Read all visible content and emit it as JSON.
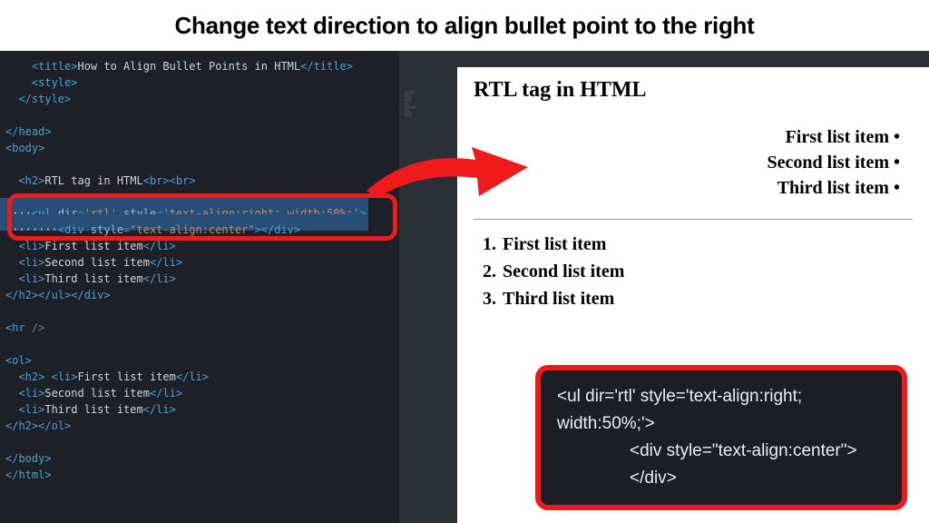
{
  "header": {
    "title": "Change text direction to align bullet point to the right"
  },
  "editor": {
    "lines": [
      {
        "indent": "    ",
        "tokens": [
          {
            "t": "tag",
            "v": "<title>"
          },
          {
            "t": "txt",
            "v": "How to Align Bullet Points in HTML"
          },
          {
            "t": "tag",
            "v": "</title>"
          }
        ]
      },
      {
        "indent": "    ",
        "tokens": [
          {
            "t": "tag",
            "v": "<style>"
          }
        ]
      },
      {
        "indent": "  ",
        "tokens": [
          {
            "t": "tag",
            "v": "</style>"
          }
        ]
      },
      {
        "indent": "",
        "blank": true
      },
      {
        "indent": "",
        "tokens": [
          {
            "t": "tag",
            "v": "</head>"
          }
        ]
      },
      {
        "indent": "",
        "tokens": [
          {
            "t": "tag",
            "v": "<body>"
          }
        ]
      },
      {
        "indent": "",
        "blank": true
      },
      {
        "indent": "  ",
        "tokens": [
          {
            "t": "tag",
            "v": "<h2>"
          },
          {
            "t": "txt",
            "v": "RTL tag in HTML"
          },
          {
            "t": "tag",
            "v": "<br>"
          },
          {
            "t": "tag",
            "v": "<br>"
          }
        ]
      },
      {
        "indent": "",
        "blank": true
      },
      {
        "sel": true,
        "indent": "    ",
        "tokens": [
          {
            "t": "tag",
            "v": "<ul "
          },
          {
            "t": "attr",
            "v": "dir"
          },
          {
            "t": "pun",
            "v": "="
          },
          {
            "t": "astr",
            "v": "'rtl'"
          },
          {
            "t": "txt",
            "v": " "
          },
          {
            "t": "attr",
            "v": "style"
          },
          {
            "t": "pun",
            "v": "="
          },
          {
            "t": "astr",
            "v": "'text-align:right; width:50%;'"
          },
          {
            "t": "tag",
            "v": ">"
          }
        ]
      },
      {
        "sel": true,
        "indent": "        ",
        "tokens": [
          {
            "t": "tag",
            "v": "<div "
          },
          {
            "t": "attr",
            "v": "style"
          },
          {
            "t": "pun",
            "v": "="
          },
          {
            "t": "astr",
            "v": "\"text-align:center\""
          },
          {
            "t": "tag",
            "v": "></div>"
          }
        ]
      },
      {
        "indent": "  ",
        "tokens": [
          {
            "t": "tag",
            "v": "<li>"
          },
          {
            "t": "txt",
            "v": "First list item"
          },
          {
            "t": "tag",
            "v": "</li>"
          }
        ]
      },
      {
        "indent": "  ",
        "tokens": [
          {
            "t": "tag",
            "v": "<li>"
          },
          {
            "t": "txt",
            "v": "Second list item"
          },
          {
            "t": "tag",
            "v": "</li>"
          }
        ]
      },
      {
        "indent": "  ",
        "tokens": [
          {
            "t": "tag",
            "v": "<li>"
          },
          {
            "t": "txt",
            "v": "Third list item"
          },
          {
            "t": "tag",
            "v": "</li>"
          }
        ]
      },
      {
        "indent": "",
        "tokens": [
          {
            "t": "tag",
            "v": "</h2>"
          },
          {
            "t": "tag",
            "v": "</ul>"
          },
          {
            "t": "tag",
            "v": "</div>"
          }
        ]
      },
      {
        "indent": "",
        "blank": true
      },
      {
        "indent": "",
        "tokens": [
          {
            "t": "tag",
            "v": "<hr "
          },
          {
            "t": "pun",
            "v": "/>"
          }
        ]
      },
      {
        "indent": "",
        "blank": true
      },
      {
        "indent": "",
        "tokens": [
          {
            "t": "tag",
            "v": "<ol>"
          }
        ]
      },
      {
        "indent": "  ",
        "tokens": [
          {
            "t": "tag",
            "v": "<h2>"
          },
          {
            "t": "txt",
            "v": " "
          },
          {
            "t": "tag",
            "v": "<li>"
          },
          {
            "t": "txt",
            "v": "First list item"
          },
          {
            "t": "tag",
            "v": "</li>"
          }
        ]
      },
      {
        "indent": "  ",
        "tokens": [
          {
            "t": "tag",
            "v": "<li>"
          },
          {
            "t": "txt",
            "v": "Second list item"
          },
          {
            "t": "tag",
            "v": "</li>"
          }
        ]
      },
      {
        "indent": "  ",
        "tokens": [
          {
            "t": "tag",
            "v": "<li>"
          },
          {
            "t": "txt",
            "v": "Third list item"
          },
          {
            "t": "tag",
            "v": "</li>"
          }
        ]
      },
      {
        "indent": "",
        "tokens": [
          {
            "t": "tag",
            "v": "</h2>"
          },
          {
            "t": "tag",
            "v": "</ol>"
          }
        ]
      },
      {
        "indent": "",
        "blank": true
      },
      {
        "indent": "",
        "tokens": [
          {
            "t": "tag",
            "v": "</body>"
          }
        ]
      },
      {
        "indent": "",
        "tokens": [
          {
            "t": "tag",
            "v": "</html>"
          }
        ]
      }
    ]
  },
  "preview": {
    "heading": "RTL tag in HTML",
    "rtl_items": [
      "First list item",
      "Second list item",
      "Third list item"
    ],
    "ol_items": [
      "First list item",
      "Second list item",
      "Third list item"
    ]
  },
  "callout": {
    "line1": "<ul dir='rtl' style='text-align:right; width:50%;'>",
    "line2": "<div style=\"text-align:center\"></div>"
  }
}
